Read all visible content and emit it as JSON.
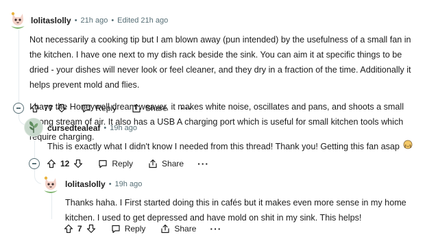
{
  "comments": [
    {
      "username": "lolitaslolly",
      "time": "21h ago",
      "edited": "Edited 21h ago",
      "paragraphs": [
        "Not necessarily a cooking tip but I am blown away (pun intended) by the usefulness of a small fan in the kitchen. I have one next to my dish rack beside the sink. You can aim it at specific things to be dried - your dishes will never look or feel cleaner, and they dry in a fraction of the time. Additionally it helps prevent mold and flies.",
        "I have the Honeywell dream weaver, it makes white noise, oscillates and pans, and shoots a small strong stream of air. It also has a USB A charging port which is useful for small kitchen tools which require charging."
      ],
      "votes": "77",
      "reply_label": "Reply",
      "share_label": "Share",
      "more_label": "···"
    },
    {
      "username": "cursedtealeaf",
      "time": "19h ago",
      "text": "This is exactly what I didn't know I needed from this thread! Thank you! Getting this fan asap",
      "votes": "12",
      "reply_label": "Reply",
      "share_label": "Share",
      "more_label": "···"
    },
    {
      "username": "lolitaslolly",
      "time": "19h ago",
      "text": "Thanks haha. I First started doing this in cafés but it makes even more sense in my home kitchen. I used to get depressed and have mold on shit in my sink. This helps!",
      "votes": "7",
      "reply_label": "Reply",
      "share_label": "Share",
      "more_label": "···"
    }
  ],
  "separator": "•",
  "colors": {
    "text": "#1c1c1c",
    "meta": "#576f76",
    "thread_line": "#e5ebee"
  },
  "icons": [
    "avatar-cat",
    "upvote-icon",
    "downvote-icon",
    "reply-icon",
    "share-icon",
    "collapse-icon",
    "more-icon",
    "emoji-icon"
  ]
}
